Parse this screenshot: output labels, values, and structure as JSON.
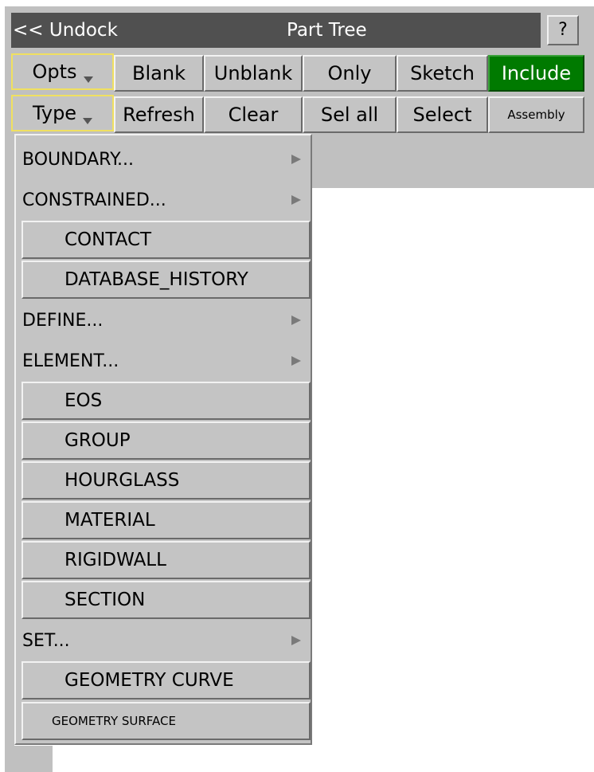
{
  "header": {
    "undock_label": "<< Undock",
    "title": "Part Tree",
    "help_label": "?"
  },
  "toolbar": {
    "row1": [
      "Opts",
      "Blank",
      "Unblank",
      "Only",
      "Sketch",
      "Include"
    ],
    "row2": [
      "Type",
      "Refresh",
      "Clear",
      "Sel all",
      "Select",
      "Assembly"
    ]
  },
  "type_menu": {
    "items": [
      {
        "label": "BOUNDARY...",
        "kind": "submenu"
      },
      {
        "label": "CONSTRAINED...",
        "kind": "submenu"
      },
      {
        "label": "CONTACT",
        "kind": "button"
      },
      {
        "label": "DATABASE_HISTORY",
        "kind": "button"
      },
      {
        "label": "DEFINE...",
        "kind": "submenu"
      },
      {
        "label": "ELEMENT...",
        "kind": "submenu"
      },
      {
        "label": "EOS",
        "kind": "button"
      },
      {
        "label": "GROUP",
        "kind": "button"
      },
      {
        "label": "HOURGLASS",
        "kind": "button"
      },
      {
        "label": "MATERIAL",
        "kind": "button"
      },
      {
        "label": "RIGIDWALL",
        "kind": "button"
      },
      {
        "label": "SECTION",
        "kind": "button"
      },
      {
        "label": "SET...",
        "kind": "submenu"
      },
      {
        "label": "GEOMETRY CURVE",
        "kind": "button"
      },
      {
        "label": "GEOMETRY SURFACE",
        "kind": "button"
      }
    ]
  },
  "colors": {
    "panel": "#c0c0c0",
    "titlebar": "#505050",
    "include_active": "#007a00",
    "focus_outline": "#f0e060"
  }
}
